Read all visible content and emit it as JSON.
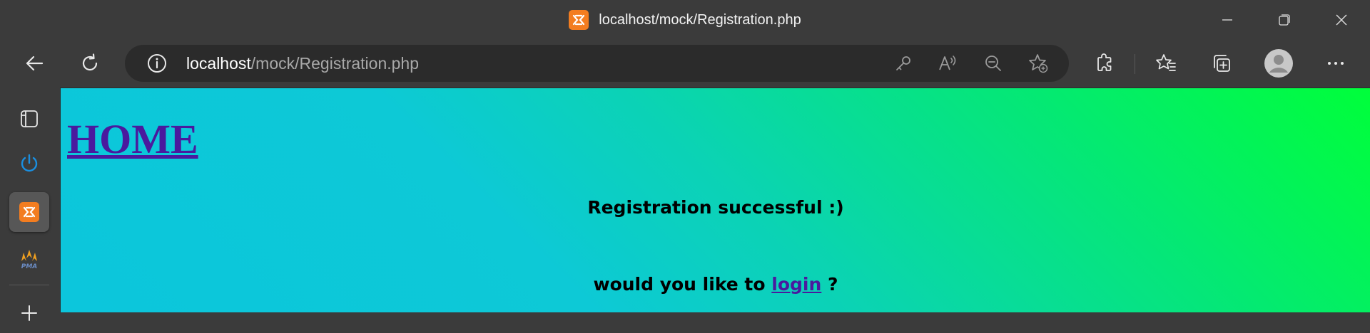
{
  "window": {
    "title": "localhost/mock/Registration.php"
  },
  "addressbar": {
    "url_host": "localhost",
    "url_path": "/mock/Registration.php"
  },
  "icons": {
    "back": "back-arrow-icon",
    "refresh": "refresh-icon",
    "site_info": "info-icon",
    "key": "key-icon",
    "read_aloud": "read-aloud-icon",
    "zoom": "zoom-out-icon",
    "favorite": "add-favorite-icon",
    "extensions": "extensions-icon",
    "favorites": "favorites-icon",
    "collections": "collections-icon",
    "profile": "profile-icon",
    "more": "more-icon"
  },
  "sidebar": {
    "items": [
      {
        "name": "tabs-icon"
      },
      {
        "name": "power-icon"
      },
      {
        "name": "xampp-icon"
      },
      {
        "name": "phpmyadmin-icon"
      },
      {
        "name": "add-icon"
      }
    ]
  },
  "page": {
    "home_link": "HOME",
    "success_message": "Registration successful :)",
    "login_prefix": "would you like to",
    "login_link": "login",
    "login_suffix": "?"
  },
  "colors": {
    "link": "#4a1a9e",
    "gradient_start": "#0cc6dc",
    "gradient_end": "#00ff3a",
    "xampp_orange": "#f37d20"
  }
}
